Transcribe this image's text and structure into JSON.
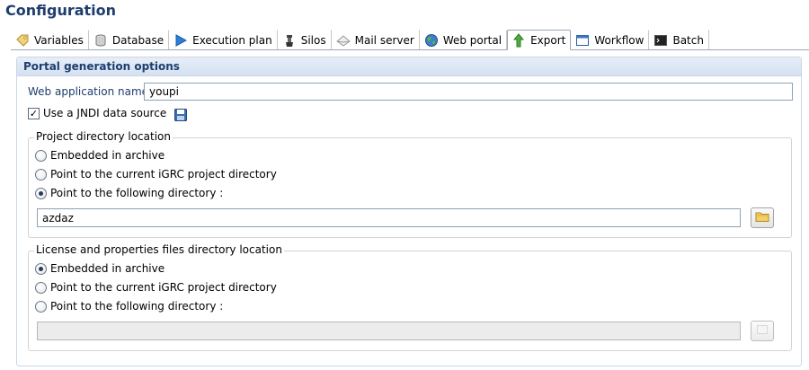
{
  "page_title": "Configuration",
  "tabs": [
    {
      "label": "Variables",
      "icon": "tag-icon"
    },
    {
      "label": "Database",
      "icon": "database-icon"
    },
    {
      "label": "Execution plan",
      "icon": "play-icon"
    },
    {
      "label": "Silos",
      "icon": "silo-icon"
    },
    {
      "label": "Mail server",
      "icon": "mail-icon"
    },
    {
      "label": "Web portal",
      "icon": "globe-icon"
    },
    {
      "label": "Export",
      "icon": "export-arrow-icon",
      "active": true
    },
    {
      "label": "Workflow",
      "icon": "workflow-window-icon"
    },
    {
      "label": "Batch",
      "icon": "terminal-icon"
    }
  ],
  "section": {
    "title": "Portal generation options",
    "web_app_label": "Web application name",
    "web_app_value": "youpi",
    "jndi_label": "Use a JNDI data source",
    "jndi_checked": true
  },
  "project_group": {
    "legend": "Project directory location",
    "options": [
      "Embedded in archive",
      "Point to the current iGRC project directory",
      "Point to the following directory :"
    ],
    "selected": 2,
    "directory_value": "azdaz"
  },
  "license_group": {
    "legend": "License and properties files directory location",
    "options": [
      "Embedded in archive",
      "Point to the current iGRC project directory",
      "Point to the following directory :"
    ],
    "selected": 0,
    "directory_value": ""
  },
  "colors": {
    "title": "#1f3d6d",
    "section_header_bg": "#dbe6f3",
    "tab_border": "#9aa6b4"
  }
}
